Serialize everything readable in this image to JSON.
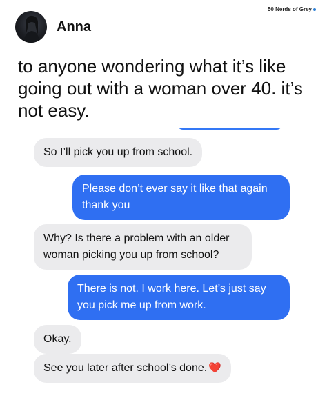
{
  "watermark": {
    "text": "50 Nerds of Grey",
    "dot_color": "#2c7fd6"
  },
  "post": {
    "author": "Anna",
    "caption": "to anyone wondering what it’s like going out with a woman over 40. it’s not easy."
  },
  "chat": {
    "colors": {
      "incoming": "#ebebed",
      "outgoing": "#2f6ff2"
    },
    "messages": [
      {
        "side": "incoming",
        "text": "So I’ll pick you up from school."
      },
      {
        "side": "outgoing",
        "text": "Please don’t ever say it like that again thank you"
      },
      {
        "side": "incoming",
        "text": "Why? Is there a problem with an older woman picking you up from school?"
      },
      {
        "side": "outgoing",
        "text": "There is not. I work here. Let’s just say you pick me up from work."
      },
      {
        "side": "incoming",
        "text": "Okay."
      },
      {
        "side": "incoming",
        "text": "See you later after school’s done.",
        "emoji": "❤️"
      }
    ]
  }
}
